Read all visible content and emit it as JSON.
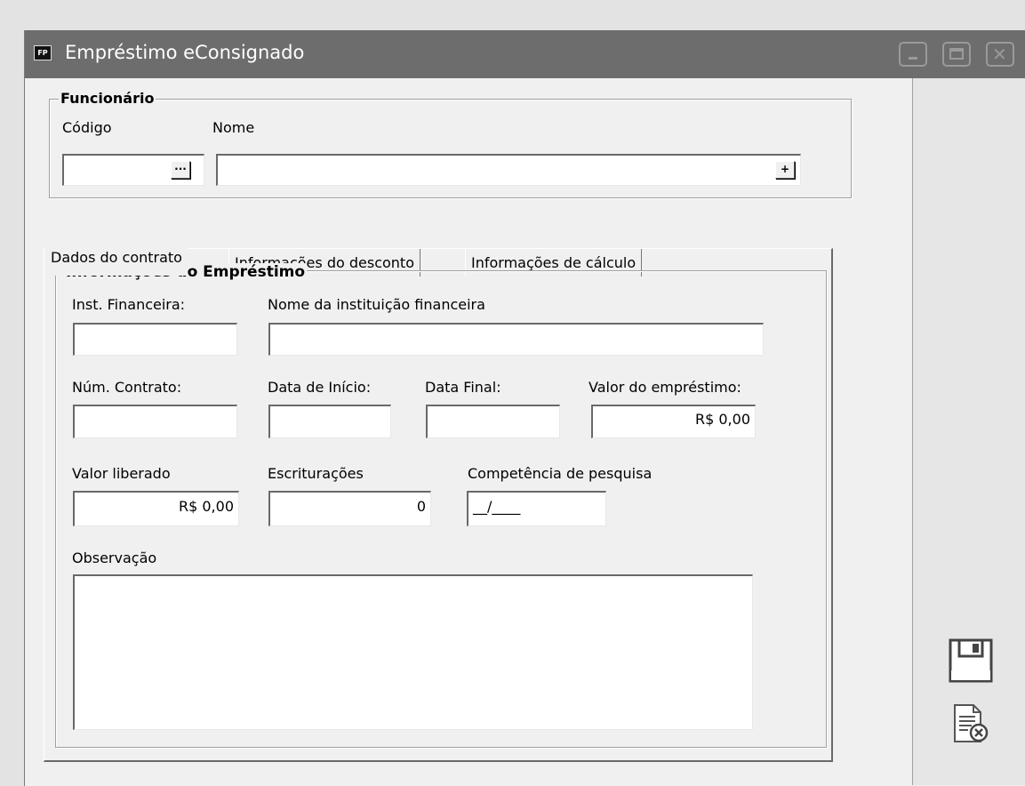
{
  "window": {
    "app_icon_text": "FP",
    "title": "Empréstimo eConsignado"
  },
  "funcionario": {
    "legend": "Funcionário",
    "codigo_label": "Código",
    "nome_label": "Nome",
    "codigo_value": "",
    "nome_value": "",
    "lookup_button": "···",
    "add_button": "+"
  },
  "tabs": [
    {
      "label": "Dados do contrato"
    },
    {
      "label": "Informações do desconto"
    },
    {
      "label": "Informações de cálculo"
    }
  ],
  "emprestimo": {
    "legend": "Informações do Empréstimo",
    "inst_label": "Inst. Financeira:",
    "nome_inst_label": "Nome da instituição financeira",
    "contrato_label": "Núm. Contrato:",
    "data_inicio_label": "Data de Início:",
    "data_final_label": "Data Final:",
    "valor_emprestimo_label": "Valor do empréstimo:",
    "valor_emprestimo_value": "R$ 0,00",
    "valor_liberado_label": "Valor liberado",
    "valor_liberado_value": "R$ 0,00",
    "escrituracoes_label": "Escriturações",
    "escrituracoes_value": "0",
    "competencia_label": "Competência de pesquisa",
    "competencia_value": "__/____",
    "observacao_label": "Observação"
  },
  "side_actions": {
    "save_icon": "floppy-disk-icon",
    "cancel_icon": "cancel-document-icon"
  }
}
